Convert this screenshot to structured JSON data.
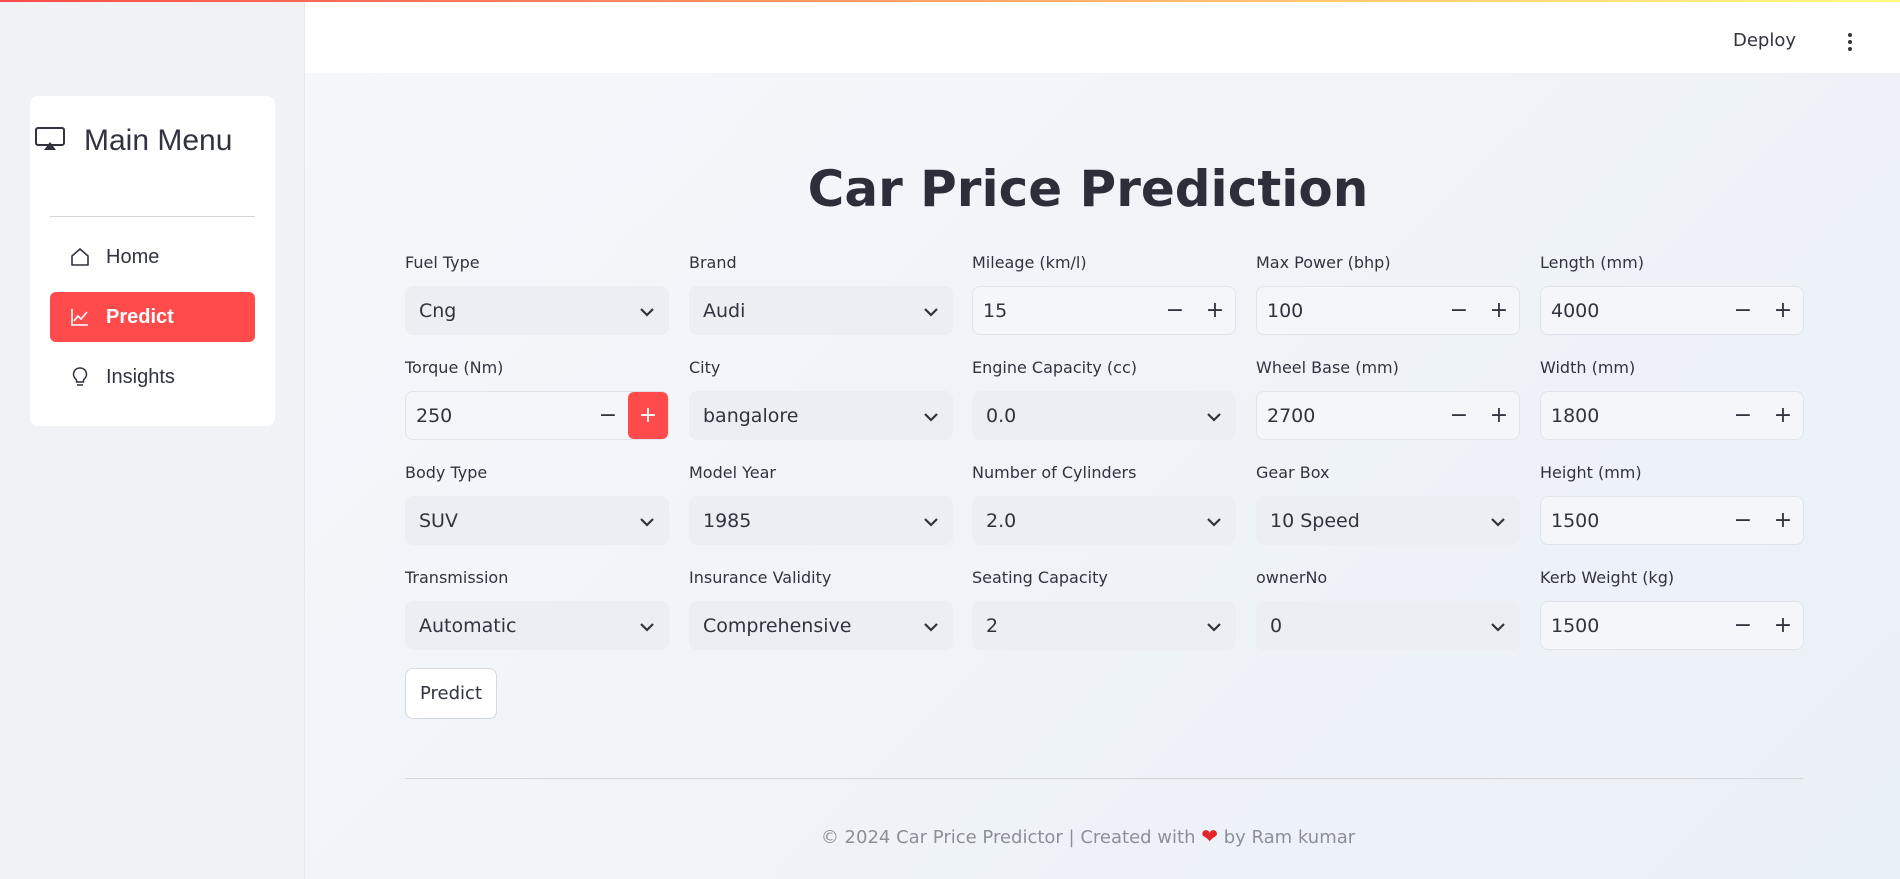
{
  "app": {
    "deploy_label": "Deploy",
    "accent": "#ff4b4b"
  },
  "sidebar": {
    "title": "Main Menu",
    "title_icon": "airplay-icon",
    "items": [
      {
        "label": "Home",
        "icon": "home-icon",
        "active": false
      },
      {
        "label": "Predict",
        "icon": "chart-line-icon",
        "active": true
      },
      {
        "label": "Insights",
        "icon": "lightbulb-icon",
        "active": false
      }
    ]
  },
  "main": {
    "title": "Car Price Prediction",
    "fields": {
      "fuel_type": {
        "label": "Fuel Type",
        "value": "Cng"
      },
      "brand": {
        "label": "Brand",
        "value": "Audi"
      },
      "mileage": {
        "label": "Mileage (km/l)",
        "value": "15"
      },
      "max_power": {
        "label": "Max Power (bhp)",
        "value": "100"
      },
      "length": {
        "label": "Length (mm)",
        "value": "4000"
      },
      "torque": {
        "label": "Torque (Nm)",
        "value": "250"
      },
      "city": {
        "label": "City",
        "value": "bangalore"
      },
      "engine_capacity": {
        "label": "Engine Capacity (cc)",
        "value": "0.0"
      },
      "wheel_base": {
        "label": "Wheel Base (mm)",
        "value": "2700"
      },
      "width": {
        "label": "Width (mm)",
        "value": "1800"
      },
      "body_type": {
        "label": "Body Type",
        "value": "SUV"
      },
      "model_year": {
        "label": "Model Year",
        "value": "1985"
      },
      "cylinders": {
        "label": "Number of Cylinders",
        "value": "2.0"
      },
      "gear_box": {
        "label": "Gear Box",
        "value": "10 Speed"
      },
      "height": {
        "label": "Height (mm)",
        "value": "1500"
      },
      "transmission": {
        "label": "Transmission",
        "value": "Automatic"
      },
      "insurance": {
        "label": "Insurance Validity",
        "value": "Comprehensive"
      },
      "seating": {
        "label": "Seating Capacity",
        "value": "2"
      },
      "owner_no": {
        "label": "ownerNo",
        "value": "0"
      },
      "kerb_weight": {
        "label": "Kerb Weight (kg)",
        "value": "1500"
      }
    },
    "stepper_minus": "−",
    "stepper_plus": "+",
    "predict_label": "Predict"
  },
  "footer": {
    "text_before": "© 2024 Car Price Predictor | Created with",
    "heart": "❤",
    "text_after": "by Ram kumar"
  }
}
